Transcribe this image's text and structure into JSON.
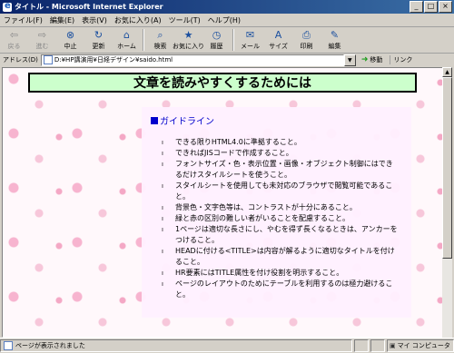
{
  "window": {
    "title": "タイトル - Microsoft Internet Explorer"
  },
  "menu": [
    "ファイル(F)",
    "編集(E)",
    "表示(V)",
    "お気に入り(A)",
    "ツール(T)",
    "ヘルプ(H)"
  ],
  "toolbar": {
    "back": "戻る",
    "forward": "進む",
    "stop": "中止",
    "refresh": "更新",
    "home": "ホーム",
    "search": "検索",
    "favorites": "お気に入り",
    "history": "履歴",
    "mail": "メール",
    "size": "サイズ",
    "print": "印刷",
    "edit": "編集"
  },
  "address": {
    "label": "アドレス(D)",
    "value": "D:¥HP講演用¥日経デザイン¥saido.html",
    "go": "移動",
    "links": "リンク"
  },
  "page": {
    "heading": "文章を読みやすくするためには",
    "section_title": "ガイドライン",
    "guidelines": [
      "できる限りHTML4.0に準拠すること。",
      "できればJISコードで作成すること。",
      "フォントサイズ・色・表示位置・画像・オブジェクト制御にはできるだけスタイルシートを使うこと。",
      "スタイルシートを使用しても未対応のブラウザで閲覧可能であること。",
      "背景色・文字色等は、コントラストが十分にあること。",
      "緑と赤の区別の難しい者がいることを配慮すること。",
      "1ページは適切な長さにし、やむを得ず長くなるときは、アンカーをつけること。",
      "HEADに付ける<TITLE>は内容が解るように適切なタイトルを付けること。",
      "HR要素にはTITLE属性を付け役割を明示すること。",
      "ページのレイアウトのためにテーブルを利用するのは極力避けること。"
    ]
  },
  "status": {
    "text": "ページが表示されました",
    "zone": "マイ コンピュータ"
  },
  "colors": {
    "heading_bg": "#ccffcc",
    "panel_bg": "#fff0ff",
    "section_title": "#0000cc",
    "titlebar": "#0a246a"
  }
}
